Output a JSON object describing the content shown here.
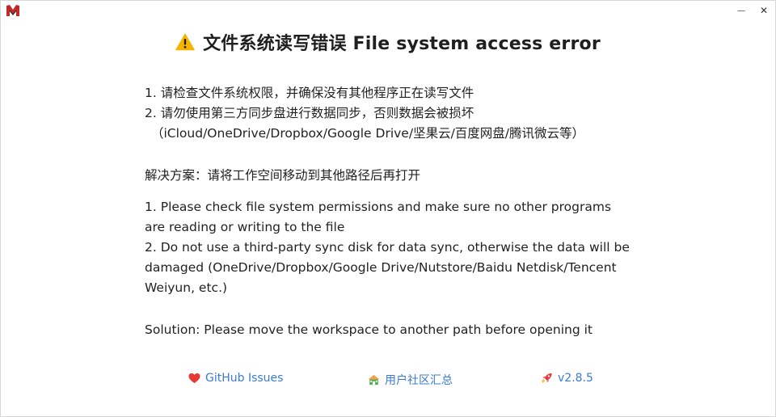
{
  "window": {
    "minimize_glyph": "—",
    "close_glyph": "✕"
  },
  "header": {
    "icon": "warning-triangle-icon",
    "title": "文件系统读写错误 File system access error"
  },
  "zh": {
    "line1": "1. 请检查文件系统权限，并确保没有其他程序正在读写文件",
    "line2": "2. 请勿使用第三方同步盘进行数据同步，否则数据会被损坏",
    "line3": "（iCloud/OneDrive/Dropbox/Google Drive/坚果云/百度网盘/腾讯微云等）",
    "solution": "解决方案：请将工作空间移动到其他路径后再打开"
  },
  "en": {
    "line1": "1. Please check file system permissions and make sure no other programs are reading or writing to the file",
    "line2": "2. Do not use a third-party sync disk for data sync, otherwise the data will be damaged (OneDrive/Dropbox/Google Drive/Nutstore/Baidu Netdisk/Tencent Weiyun, etc.)",
    "solution": "Solution: Please move the workspace to another path before opening it"
  },
  "footer": {
    "github": {
      "label": "GitHub Issues",
      "icon": "heart-icon",
      "color": "#e53935"
    },
    "community": {
      "label": "用户社区汇总",
      "icon": "house-icon",
      "color": "#4caf50"
    },
    "version": {
      "label": "v2.8.5",
      "icon": "rocket-icon",
      "color": "#e53935"
    }
  },
  "colors": {
    "link": "#3a7bd5",
    "warning": "#f5b400",
    "logo": "#c62828"
  }
}
